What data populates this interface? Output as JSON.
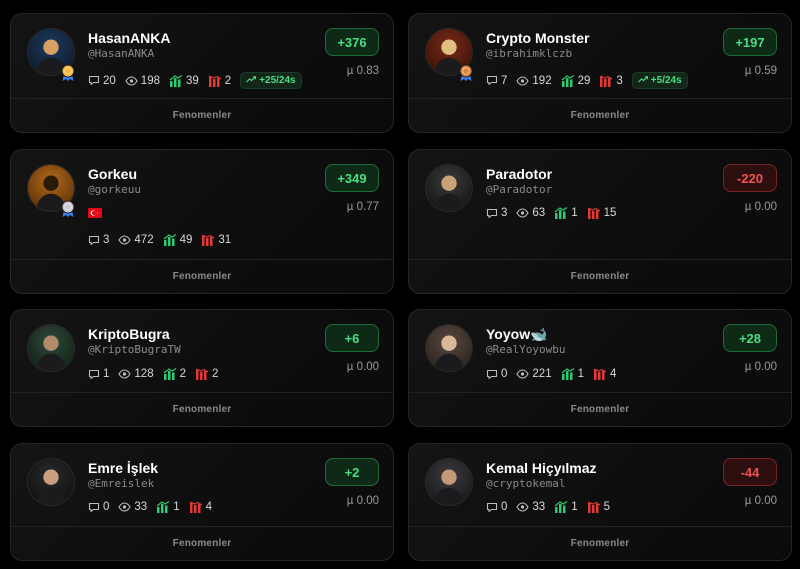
{
  "footer_label": "Fenomenler",
  "cards": [
    {
      "name": "HasanANKA",
      "handle": "@HasanANKA",
      "comments": "20",
      "views": "198",
      "up": "39",
      "down": "2",
      "streak": "+25/24s",
      "score": "+376",
      "score_type": "pos",
      "mu": "µ 0.83",
      "medal": "gold"
    },
    {
      "name": "Crypto Monster",
      "handle": "@ibrahimklczb",
      "comments": "7",
      "views": "192",
      "up": "29",
      "down": "3",
      "streak": "+5/24s",
      "score": "+197",
      "score_type": "pos",
      "mu": "µ 0.59",
      "medal": "bronze"
    },
    {
      "name": "Gorkeu",
      "handle": "@gorkeuu",
      "comments": "3",
      "views": "472",
      "up": "49",
      "down": "31",
      "score": "+349",
      "score_type": "pos",
      "mu": "µ 0.77",
      "medal": "silver",
      "flag": "turkey-flag-icon"
    },
    {
      "name": "Paradotor",
      "handle": "@Paradotor",
      "comments": "3",
      "views": "63",
      "up": "1",
      "down": "15",
      "score": "-220",
      "score_type": "neg",
      "mu": "µ 0.00"
    },
    {
      "name": "KriptoBugra",
      "handle": "@KriptoBugraTW",
      "comments": "1",
      "views": "128",
      "up": "2",
      "down": "2",
      "score": "+6",
      "score_type": "pos",
      "mu": "µ 0.00"
    },
    {
      "name": "Yoyow🐋",
      "handle": "@RealYoyowbu",
      "comments": "0",
      "views": "221",
      "up": "1",
      "down": "4",
      "score": "+28",
      "score_type": "pos",
      "mu": "µ 0.00"
    },
    {
      "name": "Emre İşlek",
      "handle": "@Emreislek",
      "comments": "0",
      "views": "33",
      "up": "1",
      "down": "4",
      "score": "+2",
      "score_type": "pos",
      "mu": "µ 0.00"
    },
    {
      "name": "Kemal Hiçyılmaz",
      "handle": "@cryptokemal",
      "comments": "0",
      "views": "33",
      "up": "1",
      "down": "5",
      "score": "-44",
      "score_type": "neg",
      "mu": "µ 0.00"
    }
  ],
  "colors": {
    "positive": "#4ade80",
    "negative": "#ef5350",
    "background": "#000000",
    "card": "#111112"
  }
}
